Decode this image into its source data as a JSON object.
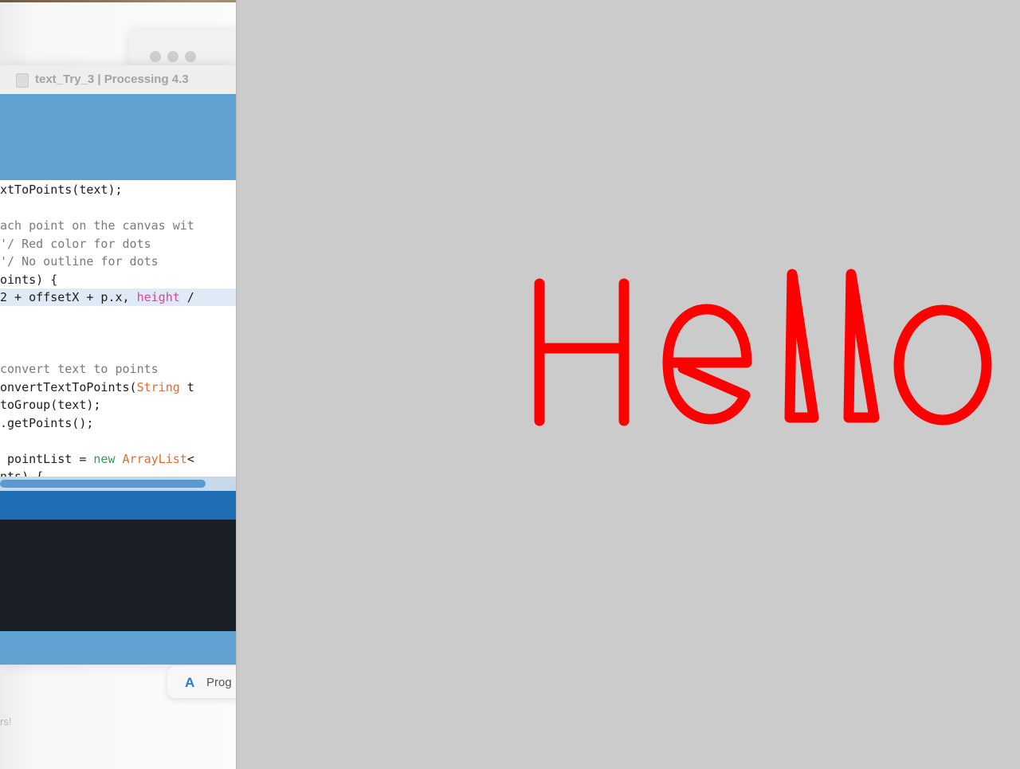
{
  "ide": {
    "window_title": "text_Try_3 | Processing 4.3",
    "code_lines": [
      {
        "segments": [
          {
            "text": "xtToPoints(text);",
            "cls": ""
          }
        ]
      },
      {
        "segments": []
      },
      {
        "segments": [
          {
            "text": "ach point on the canvas wit",
            "cls": "c-comment"
          }
        ]
      },
      {
        "segments": [
          {
            "text": "'/ Red color for dots",
            "cls": "c-comment"
          }
        ]
      },
      {
        "segments": [
          {
            "text": "'/ No outline for dots",
            "cls": "c-comment"
          }
        ]
      },
      {
        "segments": [
          {
            "text": "oints) {",
            "cls": ""
          }
        ]
      },
      {
        "segments": [
          {
            "text": "2 + offsetX + p.x, ",
            "cls": ""
          },
          {
            "text": "height",
            "cls": "c-builtin"
          },
          {
            "text": " /",
            "cls": ""
          }
        ],
        "highlighted": true
      },
      {
        "segments": []
      },
      {
        "segments": []
      },
      {
        "segments": []
      },
      {
        "segments": [
          {
            "text": "convert text to points",
            "cls": "c-comment"
          }
        ]
      },
      {
        "segments": [
          {
            "text": "onvertTextToPoints(",
            "cls": ""
          },
          {
            "text": "String",
            "cls": "c-kw"
          },
          {
            "text": " t",
            "cls": ""
          }
        ]
      },
      {
        "segments": [
          {
            "text": "toGroup(text);",
            "cls": ""
          }
        ]
      },
      {
        "segments": [
          {
            "text": ".getPoints();",
            "cls": ""
          }
        ]
      },
      {
        "segments": []
      },
      {
        "segments": [
          {
            "text": " pointList = ",
            "cls": ""
          },
          {
            "text": "new",
            "cls": "c-green"
          },
          {
            "text": " ",
            "cls": ""
          },
          {
            "text": "ArrayList",
            "cls": "c-kw"
          },
          {
            "text": "<",
            "cls": ""
          }
        ]
      },
      {
        "segments": [
          {
            "text": "nts) {",
            "cls": ""
          }
        ]
      }
    ]
  },
  "dock": {
    "icon": "app-store-icon",
    "label": "Prog"
  },
  "background": {
    "sidebar_fragment": "rs!"
  },
  "sketch": {
    "text": "Hello",
    "background_color": "#cbcbcb",
    "stroke_color": "#ff0000"
  }
}
